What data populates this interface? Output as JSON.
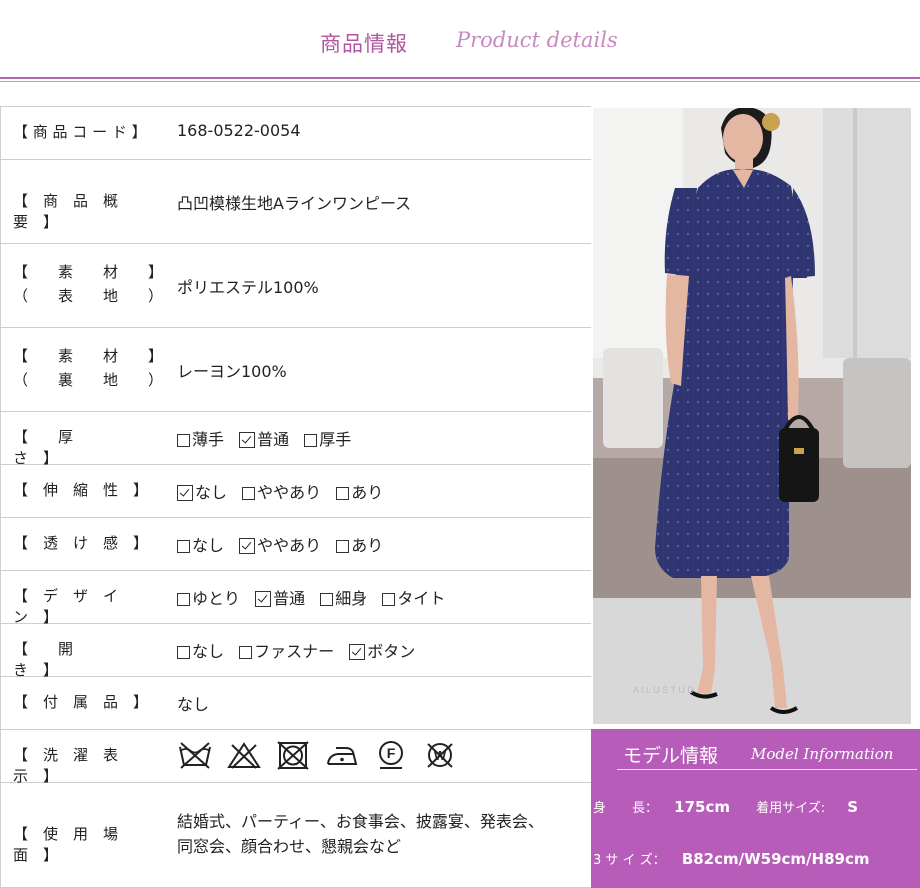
{
  "header": {
    "title_jp": "商品情報",
    "title_en": "Product details"
  },
  "spec": {
    "code_label": "【 商 品 コ ー ド 】",
    "code_value": "168-0522-0054",
    "summary_label": "【　商　品　概　要　】",
    "summary_value": "凸凹模様生地Aラインワンピース",
    "outer_label_1": "【　　素　　材　　】",
    "outer_label_2": "（　　表　　地　　）",
    "outer_value": "ポリエステル100%",
    "lining_label_1": "【　　素　　材　　】",
    "lining_label_2": "（　　裏　　地　　）",
    "lining_value": "レーヨン100%",
    "thickness_label": "【　　厚　　　　さ　】",
    "thickness_options": [
      "薄手",
      "普通",
      "厚手"
    ],
    "stretch_label": "【　伸　縮　性　】",
    "stretch_options": [
      "なし",
      "ややあり",
      "あり"
    ],
    "sheer_label": "【　透　け　感　】",
    "sheer_options": [
      "なし",
      "ややあり",
      "あり"
    ],
    "design_label": "【　デ　ザ　イ　ン　】",
    "design_options": [
      "ゆとり",
      "普通",
      "細身",
      "タイト"
    ],
    "opening_label": "【　　開　　　　き　】",
    "opening_options": [
      "なし",
      "ファスナー",
      "ボタン"
    ],
    "accessory_label": "【　付　属　品　】",
    "accessory_value": "なし",
    "care_label": "【　洗　濯　表　示　】",
    "care_icons": [
      "no-wash-icon",
      "no-bleach-icon",
      "no-tumble-dry-icon",
      "iron-low-icon",
      "dry-clean-f-icon",
      "no-wet-clean-icon"
    ],
    "scene_label": "【　使　用　場　面　】",
    "scene_line_1": "結婚式、パーティー、お食事会、披露宴、発表会、",
    "scene_line_2": "同窓会、顔合わせ、懇親会など"
  },
  "model": {
    "title_jp": "モデル情報",
    "title_en": "Model Information",
    "height_label": "身　　長：",
    "height_value": "175cm",
    "size_label": "着用サイズ:",
    "size_value": "S",
    "measure_label": "3 サ イ ズ：",
    "measure_value": "B82cm/W59cm/H89cm"
  },
  "photo": {
    "watermark": "A   I   L   U   S   T   U   D"
  },
  "colors": {
    "accent": "#b85cba",
    "title": "#b0559f",
    "dress": "#2e3570"
  }
}
